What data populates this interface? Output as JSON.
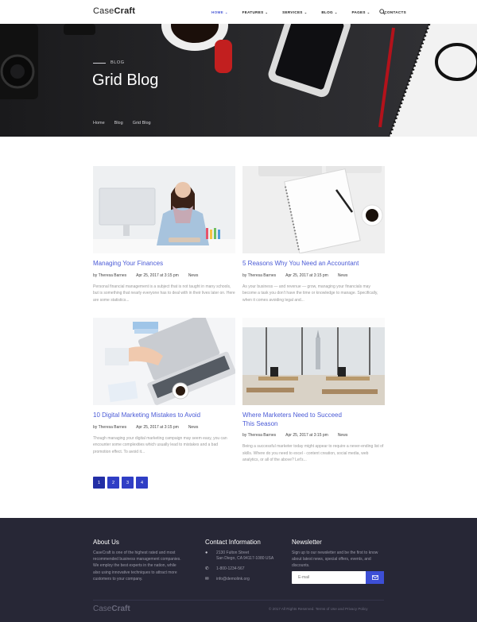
{
  "brand": {
    "logo_part1": "Case",
    "logo_part2": "Craft"
  },
  "nav": {
    "items": [
      {
        "label": "HOME"
      },
      {
        "label": "FEATURES"
      },
      {
        "label": "SERVICES"
      },
      {
        "label": "BLOG"
      },
      {
        "label": "PAGES"
      },
      {
        "label": "CONTACTS"
      }
    ]
  },
  "hero": {
    "label": "BLOG",
    "title": "Grid Blog",
    "breadcrumb": [
      "Home",
      "Blog",
      "Grid Blog"
    ]
  },
  "posts": [
    {
      "title": "Managing Your Finances",
      "author": "by Theresa Barnes",
      "date": "Apr 25, 2017 at 3:15 pm",
      "category": "News",
      "excerpt": "Personal financial management is a subject that is not taught in many schools, but is something that nearly everyone has to deal with in their lives later on. Here are some statistics..."
    },
    {
      "title": "5 Reasons Why You Need an Accountant",
      "author": "by Theresa Barnes",
      "date": "Apr 25, 2017 at 3:15 pm",
      "category": "News",
      "excerpt": "As your business — and revenue — grow, managing your financials may become a task you don't have the time or knowledge to manage. Specifically, when it comes avoiding legal and..."
    },
    {
      "title": "10 Digital Marketing Mistakes to Avoid",
      "author": "by Theresa Barnes",
      "date": "Apr 25, 2017 at 3:15 pm",
      "category": "News",
      "excerpt": "Though managing your digital marketing campaign may seem easy, you can encounter some complexities which usually lead to mistakes and a bad promotion effect. To avoid it..."
    },
    {
      "title_line1": "Where Marketers Need to Succeed",
      "title_line2": "This Season",
      "author": "by Theresa Barnes",
      "date": "Apr 25, 2017 at 3:15 pm",
      "category": "News",
      "excerpt": "Being a successful marketer today might appear to require a never-ending list of skills. Where do you need to excel - content creation, social media, web analytics, or all of the above? Let's..."
    }
  ],
  "pagination": [
    "1",
    "2",
    "3",
    "4"
  ],
  "footer": {
    "about_title": "About Us",
    "about_text": "CaseCraft is one of the highest rated and most recommended business management companies. We employ the best experts in the nation, while also using innovative techniques to attract more customers to your company.",
    "contact_title": "Contact Information",
    "address_line1": "2130 Fulton Street",
    "address_line2": "San Diego, CA 94117-1080 USA",
    "phone": "1-800-1234-567",
    "email": "info@demolink.org",
    "newsletter_title": "Newsletter",
    "newsletter_text": "Sign up to our newsletter and be the first to know about latest news, special offers, events, and discounts.",
    "email_placeholder": "E-mail",
    "copyright": "© 2017 All Rights Reserved. Terms of Use and Privacy Policy"
  },
  "colors": {
    "accent": "#4b5bd6",
    "button": "#2f3ec5",
    "footer_bg": "#272736"
  }
}
